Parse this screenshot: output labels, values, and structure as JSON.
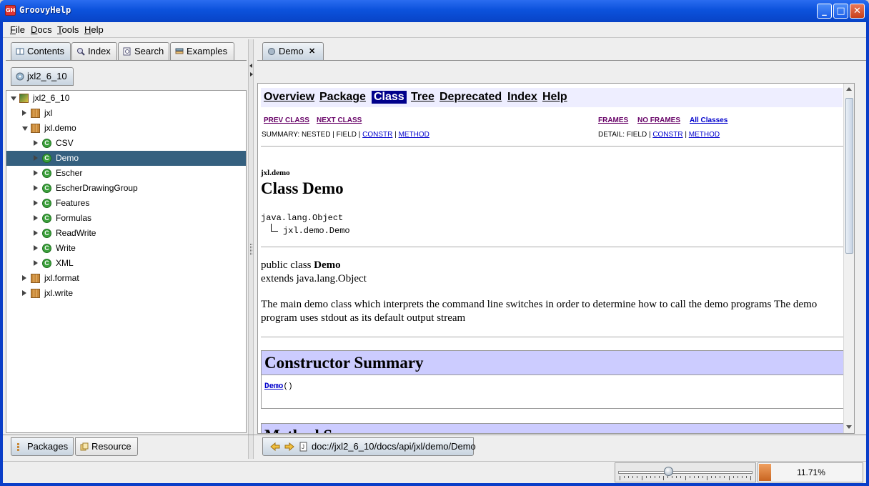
{
  "window": {
    "title": "GroovyHelp",
    "icon_text": "GH"
  },
  "menu": [
    {
      "label": "File",
      "mnemonic": "F",
      "rest": "ile"
    },
    {
      "label": "Docs",
      "mnemonic": "D",
      "rest": "ocs"
    },
    {
      "label": "Tools",
      "mnemonic": "T",
      "rest": "ools"
    },
    {
      "label": "Help",
      "mnemonic": "H",
      "rest": "elp"
    }
  ],
  "left_tabs": [
    "Contents",
    "Index",
    "Search",
    "Examples"
  ],
  "book_tab": "jxl2_6_10",
  "tree": [
    {
      "label": "jxl2_6_10",
      "kind": "root",
      "depth": 0,
      "expanded": true
    },
    {
      "label": "jxl",
      "kind": "package",
      "depth": 1,
      "expanded": false
    },
    {
      "label": "jxl.demo",
      "kind": "package",
      "depth": 1,
      "expanded": true
    },
    {
      "label": "CSV",
      "kind": "class",
      "depth": 2,
      "expanded": false
    },
    {
      "label": "Demo",
      "kind": "class",
      "depth": 2,
      "expanded": false,
      "selected": true
    },
    {
      "label": "Escher",
      "kind": "class",
      "depth": 2,
      "expanded": false
    },
    {
      "label": "EscherDrawingGroup",
      "kind": "class",
      "depth": 2,
      "expanded": false
    },
    {
      "label": "Features",
      "kind": "class",
      "depth": 2,
      "expanded": false
    },
    {
      "label": "Formulas",
      "kind": "class",
      "depth": 2,
      "expanded": false
    },
    {
      "label": "ReadWrite",
      "kind": "class",
      "depth": 2,
      "expanded": false
    },
    {
      "label": "Write",
      "kind": "class",
      "depth": 2,
      "expanded": false
    },
    {
      "label": "XML",
      "kind": "class",
      "depth": 2,
      "expanded": false
    },
    {
      "label": "jxl.format",
      "kind": "package",
      "depth": 1,
      "expanded": false
    },
    {
      "label": "jxl.write",
      "kind": "package",
      "depth": 1,
      "expanded": false
    }
  ],
  "bottom_tabs": [
    "Packages",
    "Resource"
  ],
  "doc_tab": "Demo",
  "javadoc": {
    "nav": [
      "Overview",
      "Package",
      "Class",
      "Tree",
      "Deprecated",
      "Index",
      "Help"
    ],
    "nav_selected": "Class",
    "prev_class": "PREV CLASS",
    "next_class": "NEXT CLASS",
    "frames": "FRAMES",
    "no_frames": "NO FRAMES",
    "all_classes": "All Classes",
    "summary_prefix": "SUMMARY: NESTED | FIELD |",
    "detail_prefix": "DETAIL: FIELD |",
    "constr": "CONSTR",
    "method": "METHOD",
    "sep": "|",
    "package": "jxl.demo",
    "class_title": "Class Demo",
    "hierarchy_parent": "java.lang.Object",
    "hierarchy_child": "jxl.demo.Demo",
    "decl_prefix": "public class",
    "decl_name": "Demo",
    "decl_extends": "extends java.lang.Object",
    "description": "The main demo class which interprets the command line switches in order to determine how to call the demo programs The demo program uses stdout as its default output stream",
    "constructor_summary": "Constructor Summary",
    "constructor_link": "Demo",
    "constructor_args": "()",
    "method_summary": "Method Summary"
  },
  "address": "doc://jxl2_6_10/docs/api/jxl/demo/Demo",
  "zoom": {
    "label": "11.71%",
    "fraction": 0.1171,
    "slider_fraction": 0.35
  },
  "colors": {
    "title_bar": "#0c52dc",
    "selection": "#35607f",
    "summary_header": "#ccccff",
    "nav_selected": "#00008b"
  }
}
